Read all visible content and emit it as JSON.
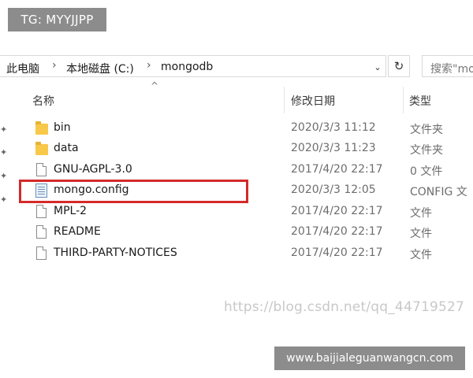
{
  "overlay": {
    "tg_label": "TG: MYYJJPP",
    "site_label": "www.baijialeguanwangcn.com",
    "watermark": "https://blog.csdn.net/qq_44719527"
  },
  "address_bar": {
    "crumbs": [
      "此电脑",
      "本地磁盘 (C:)",
      "mongodb"
    ],
    "separator": "›",
    "dropdown_icon": "chevron-down-icon",
    "refresh_icon": "refresh-icon"
  },
  "search": {
    "placeholder": "搜索\"mo"
  },
  "columns": {
    "name": "名称",
    "date": "修改日期",
    "type": "类型",
    "sort_indicator": "^"
  },
  "files": [
    {
      "name": "bin",
      "date": "2020/3/3 11:12",
      "type": "文件夹",
      "icon": "folder-icon"
    },
    {
      "name": "data",
      "date": "2020/3/3 11:23",
      "type": "文件夹",
      "icon": "folder-icon"
    },
    {
      "name": "GNU-AGPL-3.0",
      "date": "2017/4/20 22:17",
      "type": "0 文件",
      "icon": "file-icon"
    },
    {
      "name": "mongo.config",
      "date": "2020/3/3 12:05",
      "type": "CONFIG 文",
      "icon": "config-file-icon",
      "highlighted": true
    },
    {
      "name": "MPL-2",
      "date": "2017/4/20 22:17",
      "type": "文件",
      "icon": "file-icon"
    },
    {
      "name": "README",
      "date": "2017/4/20 22:17",
      "type": "文件",
      "icon": "file-icon"
    },
    {
      "name": "THIRD-PARTY-NOTICES",
      "date": "2017/4/20 22:17",
      "type": "文件",
      "icon": "file-icon"
    }
  ],
  "colors": {
    "highlight_border": "#d42a2a",
    "folder": "#f8c84a",
    "badge_bg": "#8c8c8c"
  }
}
